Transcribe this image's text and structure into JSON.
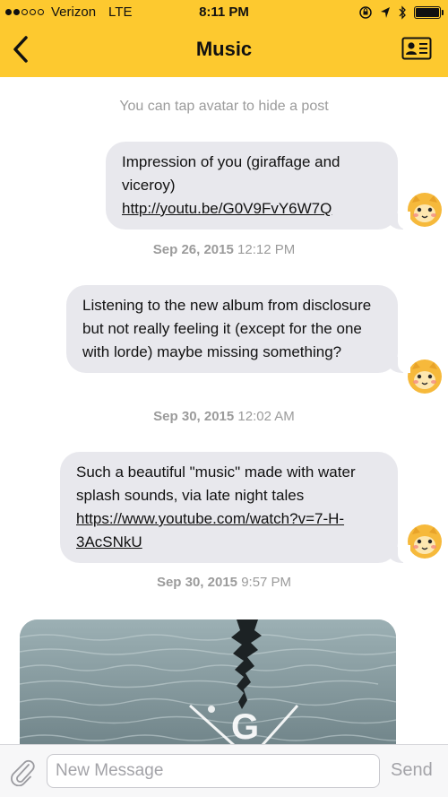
{
  "status_bar": {
    "carrier": "Verizon",
    "network": "LTE",
    "time": "8:11 PM"
  },
  "nav": {
    "title": "Music",
    "back_icon": "chevron-left-icon",
    "profile_icon": "id-card-icon"
  },
  "hint": "You can tap avatar to hide a post",
  "messages": [
    {
      "text_before": "Impression of you (giraffage and viceroy) ",
      "link": "http://youtu.be/G0V9FvY6W7Q",
      "date": "Sep 26, 2015",
      "time": "12:12 PM"
    },
    {
      "text_before": "Listening to the new album from disclosure but not really feeling it (except for the one with lorde) maybe missing something?",
      "date": "Sep 30, 2015",
      "time": "12:02 AM"
    },
    {
      "text_before": "Such a beautiful \"music\" made with water splash sounds, via late night tales ",
      "link": "https://www.youtube.com/watch?v=7-H-3AcSNkU",
      "date": "Sep 30, 2015",
      "time": "9:57 PM"
    }
  ],
  "photo_overlay_letter": "G",
  "input_bar": {
    "placeholder": "New Message",
    "send_label": "Send",
    "attach_icon": "paperclip-icon"
  },
  "colors": {
    "nav_background": "#fdc92f",
    "bubble_background": "#e8e8ed",
    "muted_text": "#9b9b9b"
  }
}
